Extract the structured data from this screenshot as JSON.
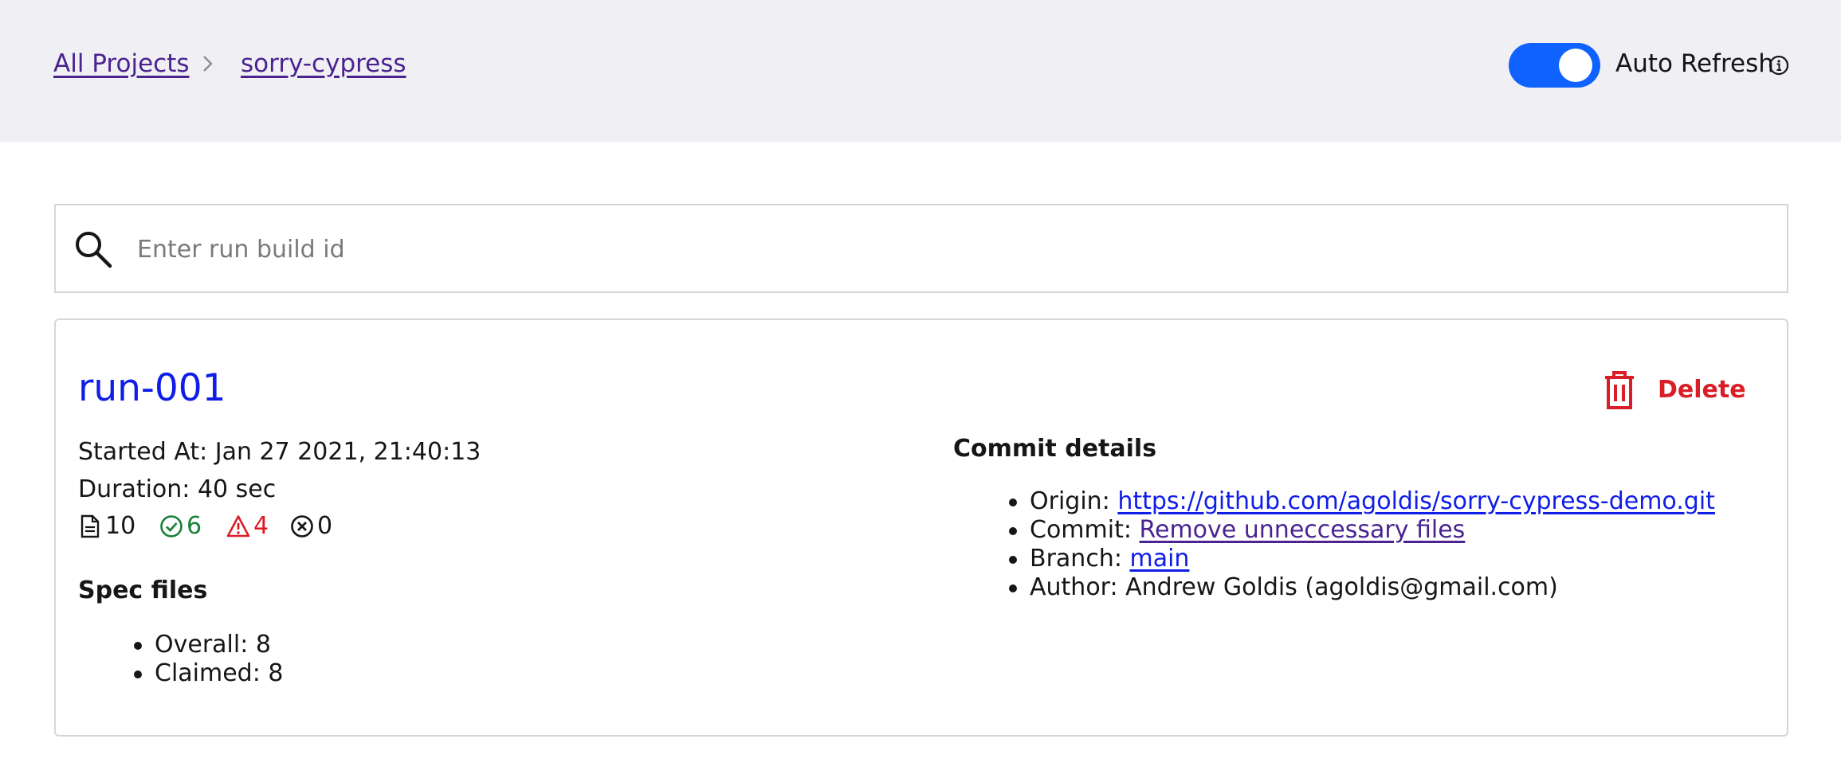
{
  "header": {
    "breadcrumb": [
      {
        "label": "All Projects"
      },
      {
        "label": "sorry-cypress"
      }
    ],
    "auto_refresh": {
      "label": "Auto Refresh",
      "enabled": true
    }
  },
  "search": {
    "placeholder": "Enter run build id",
    "value": ""
  },
  "run": {
    "title": "run-001",
    "delete_label": "Delete",
    "started_at": "Started At: Jan 27 2021, 21:40:13",
    "duration": "Duration: 40 sec",
    "stats": {
      "tests": "10",
      "passed": "6",
      "failed": "4",
      "skipped": "0"
    },
    "spec_files": {
      "heading": "Spec files",
      "overall": "Overall: 8",
      "claimed": "Claimed: 8"
    },
    "commit": {
      "heading": "Commit details",
      "origin_label": "Origin: ",
      "origin_value": "https://github.com/agoldis/sorry-cypress-demo.git",
      "commit_label": "Commit: ",
      "commit_value": "Remove unneccessary files",
      "branch_label": "Branch: ",
      "branch_value": "main",
      "author": "Author: Andrew Goldis (agoldis@gmail.com)"
    }
  },
  "colors": {
    "accent": "#0f62fe",
    "link": "#0f1de6",
    "visited_link": "#4a2390",
    "danger": "#da1e28",
    "success": "#198038",
    "header_bg": "#f0f0f4"
  },
  "icons": [
    "chevron-right-icon",
    "info-icon",
    "search-icon",
    "trash-icon",
    "document-icon",
    "check-circle-icon",
    "warning-icon",
    "x-circle-icon"
  ]
}
